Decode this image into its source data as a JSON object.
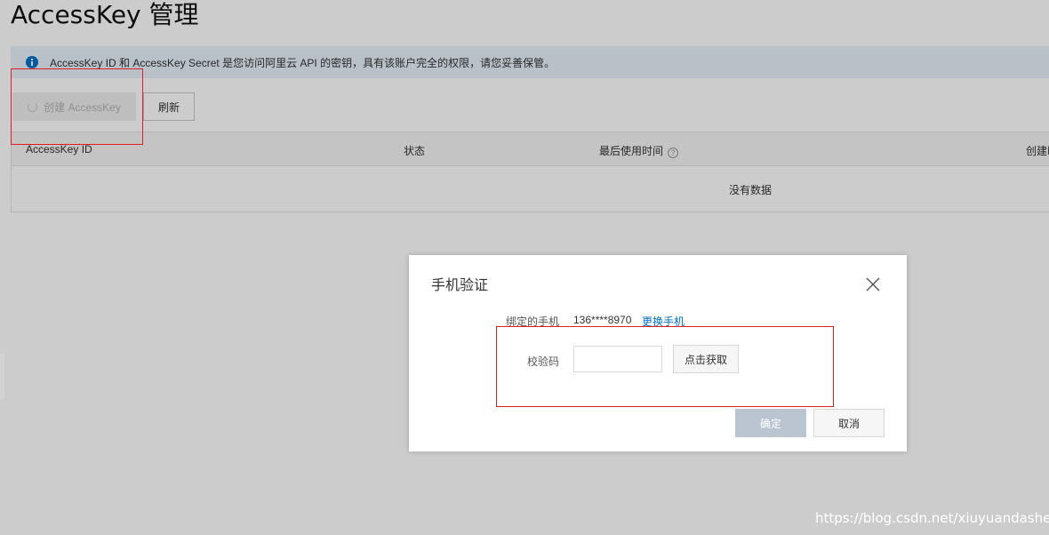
{
  "page": {
    "title": "AccessKey 管理",
    "notice": "AccessKey ID 和 AccessKey Secret 是您访问阿里云 API 的密钥，具有该账户完全的权限，请您妥善保管。"
  },
  "toolbar": {
    "create_label": "创建 AccessKey",
    "create_state": "loading",
    "refresh_label": "刷新"
  },
  "table": {
    "columns": [
      "AccessKey ID",
      "状态",
      "最后使用时间",
      "创建时"
    ],
    "empty_text": "没有数据"
  },
  "dialog": {
    "title": "手机验证",
    "phone_label": "绑定的手机",
    "phone_value": "136****8970",
    "change_phone_link": "更换手机",
    "code_label": "校验码",
    "code_value": "",
    "get_code_label": "点击获取",
    "confirm_label": "确定",
    "cancel_label": "取消"
  },
  "watermark": "https://blog.csdn.net/xiuyuandashen",
  "colors": {
    "accent": "#0070cc",
    "annotation": "#e02020",
    "info_bg": "#e6f0fa",
    "disabled_btn": "#bbc5d1"
  },
  "icons": [
    "info-icon",
    "loading-spinner-icon",
    "help-icon",
    "close-icon"
  ]
}
